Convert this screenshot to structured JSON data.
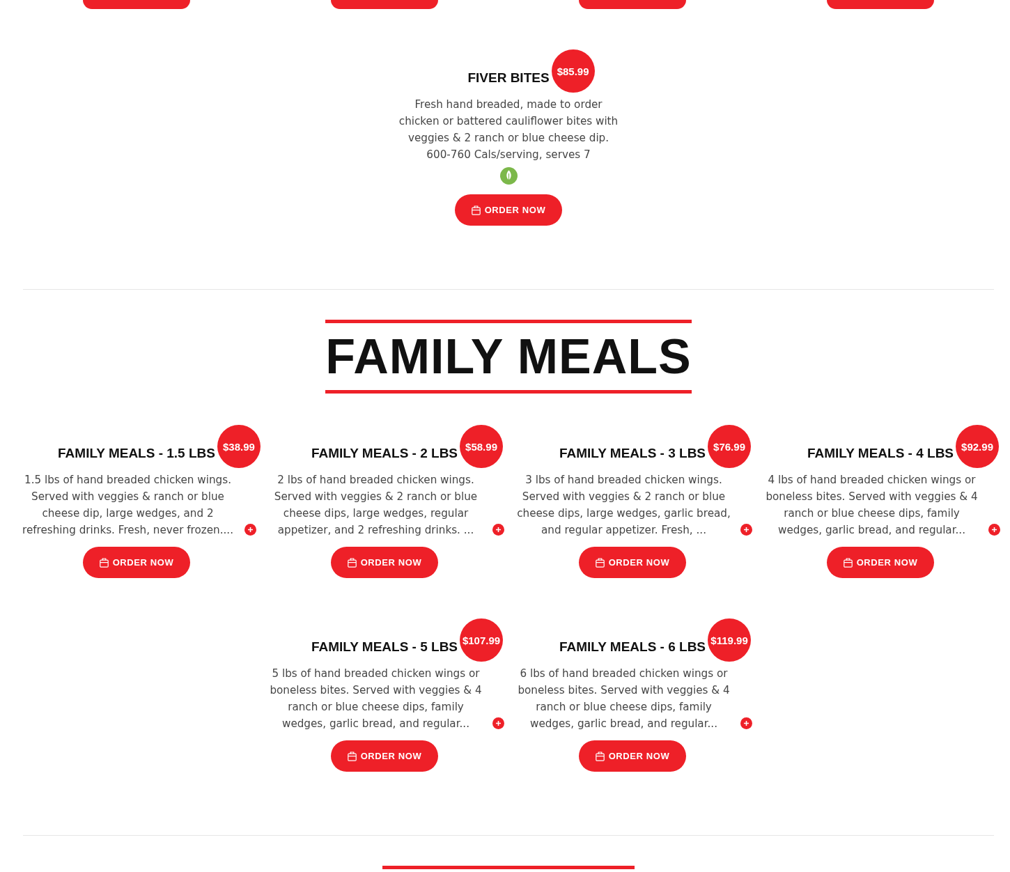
{
  "cut_off_buttons": [
    {
      "kind": "order_button"
    },
    {
      "kind": "order_button"
    },
    {
      "kind": "order_button"
    },
    {
      "kind": "order_button"
    }
  ],
  "sections": [
    {
      "kind": "items",
      "items": [
        {
          "title": "FIVER BITES",
          "price": "$85.99",
          "description": "Fresh hand breaded, made to order chicken or battered cauliflower bites with veggies & 2 ranch or blue cheese dip. 600-760 Cals/serving, serves 7",
          "expandable": false,
          "vegetarian": true,
          "button": "ORDER NOW"
        }
      ]
    },
    {
      "kind": "headed",
      "heading": "FAMILY MEALS",
      "items": [
        {
          "title": "FAMILY MEALS - 1.5 LBS",
          "price": "$38.99",
          "description": "1.5 lbs of hand breaded chicken wings. Served with veggies & ranch or blue cheese dip, large wedges, and 2 refreshing drinks. Fresh, never frozen....",
          "expandable": true,
          "vegetarian": false,
          "button": "ORDER NOW"
        },
        {
          "title": "FAMILY MEALS - 2 LBS",
          "price": "$58.99",
          "description": "2 lbs of hand breaded chicken wings. Served with veggies & 2 ranch or blue cheese dips, large wedges, regular appetizer, and 2 refreshing drinks. ...",
          "expandable": true,
          "vegetarian": false,
          "button": "ORDER NOW"
        },
        {
          "title": "FAMILY MEALS - 3 LBS",
          "price": "$76.99",
          "description": "3 lbs of hand breaded chicken wings. Served with veggies & 2 ranch or blue cheese dips, large wedges, garlic bread, and regular appetizer. Fresh, ...",
          "expandable": true,
          "vegetarian": false,
          "button": "ORDER NOW"
        },
        {
          "title": "FAMILY MEALS - 4 LBS",
          "price": "$92.99",
          "description": "4 lbs of hand breaded chicken wings or boneless bites. Served with veggies & 4 ranch or blue cheese dips, family wedges, garlic bread, and regular...",
          "expandable": true,
          "vegetarian": false,
          "button": "ORDER NOW"
        },
        {
          "title": "FAMILY MEALS - 5 LBS",
          "price": "$107.99",
          "description": "5 lbs of hand breaded chicken wings or boneless bites. Served with veggies & 4 ranch or blue cheese dips, family wedges, garlic bread, and regular...",
          "expandable": true,
          "vegetarian": false,
          "button": "ORDER NOW"
        },
        {
          "title": "FAMILY MEALS - 6 LBS",
          "price": "$119.99",
          "description": "6 lbs of hand breaded chicken wings or boneless bites. Served with veggies & 4 ranch or blue cheese dips, family wedges, garlic bread, and regular...",
          "expandable": true,
          "vegetarian": false,
          "button": "ORDER NOW"
        }
      ]
    },
    {
      "kind": "heading_cut"
    }
  ]
}
